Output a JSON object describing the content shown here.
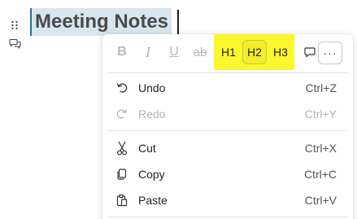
{
  "document": {
    "heading": "Meeting Notes"
  },
  "toolbar": {
    "bold_label": "B",
    "italic_label": "I",
    "underline_label": "U",
    "strikethrough_label": "ab",
    "h1_label": "H1",
    "h2_label": "H2",
    "h3_label": "H3",
    "more_label": "···",
    "heading_highlight_color": "#fbf72e"
  },
  "menu": {
    "items": [
      {
        "label": "Undo",
        "shortcut": "Ctrl+Z",
        "icon": "undo-icon",
        "enabled": true
      },
      {
        "label": "Redo",
        "shortcut": "Ctrl+Y",
        "icon": "redo-icon",
        "enabled": false
      },
      {
        "label": "Cut",
        "shortcut": "Ctrl+X",
        "icon": "scissors-icon",
        "enabled": true
      },
      {
        "label": "Copy",
        "shortcut": "Ctrl+C",
        "icon": "copy-icon",
        "enabled": true
      },
      {
        "label": "Paste",
        "shortcut": "Ctrl+V",
        "icon": "clipboard-icon",
        "enabled": true
      }
    ]
  }
}
